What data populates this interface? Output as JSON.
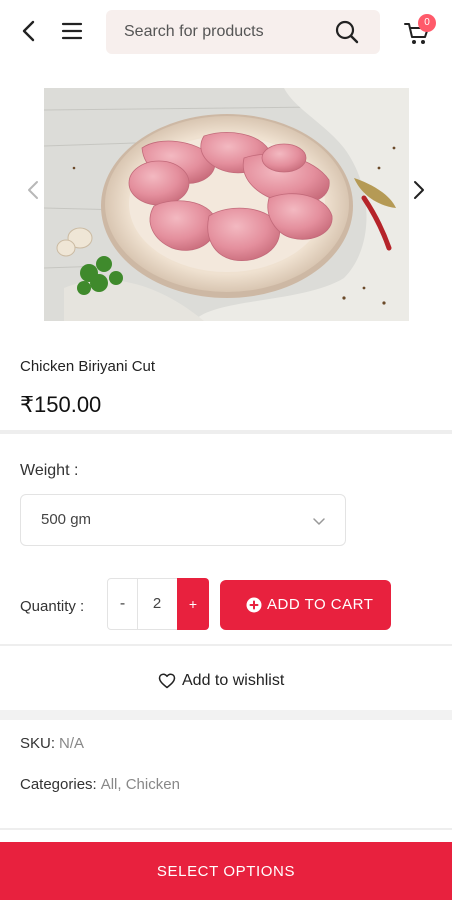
{
  "header": {
    "search_placeholder": "Search for products",
    "cart_count": "0"
  },
  "product": {
    "title": "Chicken Biriyani Cut",
    "price": "₹150.00"
  },
  "options": {
    "weight_label": "Weight :",
    "weight_value": "500 gm",
    "quantity_label": "Quantity :",
    "qty_minus": "-",
    "qty_value": "2",
    "qty_plus": "+",
    "add_to_cart": "ADD TO CART"
  },
  "wishlist": {
    "label": "Add to wishlist"
  },
  "meta": {
    "sku_key": "SKU:",
    "sku_value": "N/A",
    "categories_key": "Categories:",
    "categories_value": "All,  Chicken"
  },
  "footer": {
    "select_options": "SELECT OPTIONS"
  },
  "colors": {
    "accent": "#e8213e",
    "search_bg": "#f7efed",
    "badge": "#ff5a6a"
  },
  "icons": [
    "back-arrow-icon",
    "menu-icon",
    "search-icon",
    "cart-icon",
    "chevron-left-icon",
    "chevron-right-icon",
    "chevron-down-icon",
    "plus-circle-icon",
    "heart-icon"
  ]
}
